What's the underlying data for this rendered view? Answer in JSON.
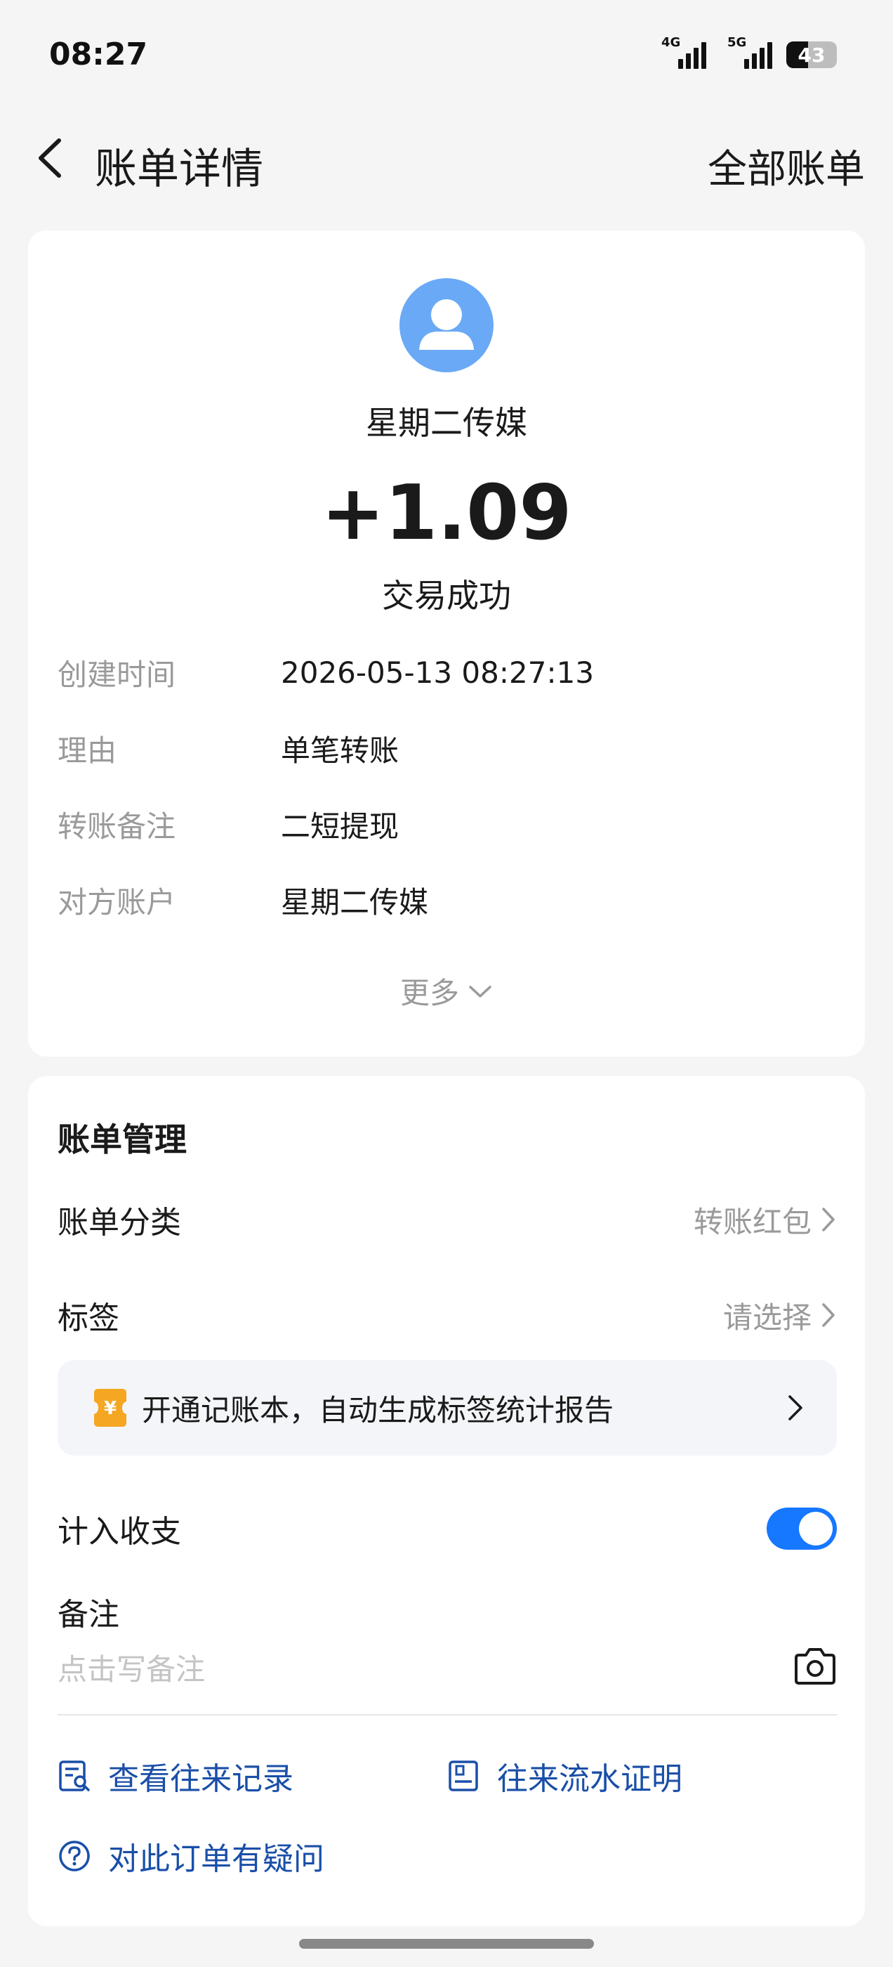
{
  "status_bar": {
    "time": "08:27",
    "net1": "4G",
    "net2": "5G",
    "battery": "43"
  },
  "nav": {
    "title": "账单详情",
    "action": "全部账单"
  },
  "summary": {
    "counterparty": "星期二传媒",
    "amount": "+1.09",
    "status": "交易成功"
  },
  "details": [
    {
      "label": "创建时间",
      "value": "2026-05-13 08:27:13"
    },
    {
      "label": "理由",
      "value": "单笔转账"
    },
    {
      "label": "转账备注",
      "value": "二短提现"
    },
    {
      "label": "对方账户",
      "value": "星期二传媒"
    }
  ],
  "more_label": "更多",
  "management": {
    "title": "账单管理",
    "category_label": "账单分类",
    "category_value": "转账红包",
    "tag_label": "标签",
    "tag_value": "请选择",
    "promo_text": "开通记账本，自动生成标签统计报告",
    "count_label": "计入收支",
    "count_enabled": true,
    "memo_label": "备注",
    "memo_placeholder": "点击写备注",
    "link_records": "查看往来记录",
    "link_proof": "往来流水证明",
    "link_question": "对此订单有疑问"
  }
}
